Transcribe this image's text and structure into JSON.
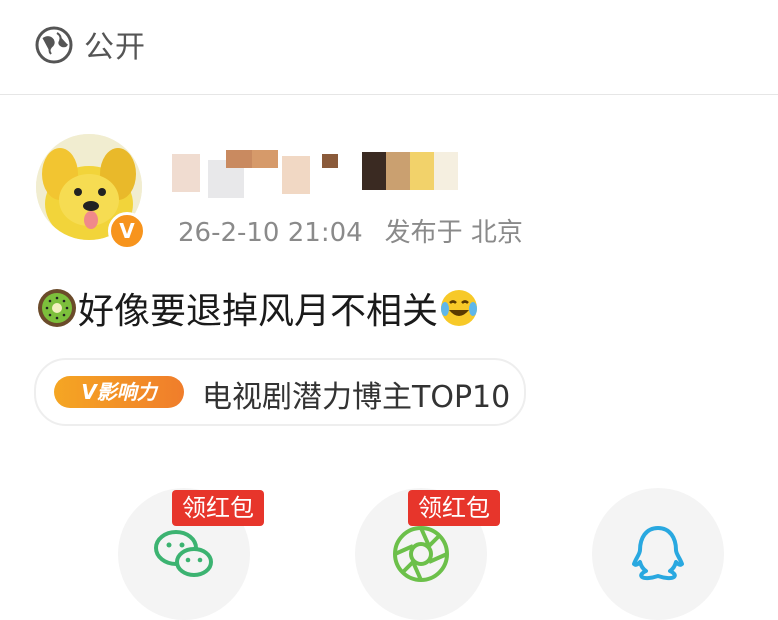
{
  "header": {
    "visibility": "公开",
    "icon": "globe-icon"
  },
  "post": {
    "author_avatar": "avatar-dog",
    "verified_badge": "V",
    "timestamp": "26-2-10 21:04",
    "location": "发布于 北京",
    "text": "好像要退掉风月不相关",
    "leading_emoji": "kiwi-emoji",
    "trailing_emoji": "laugh-cry-emoji"
  },
  "influence": {
    "badge": "V影响力",
    "text": "电视剧潜力博主TOP10"
  },
  "share": {
    "buttons": [
      {
        "name": "wechat",
        "icon": "wechat-icon",
        "tag": "领红包"
      },
      {
        "name": "moments",
        "icon": "moments-icon",
        "tag": "领红包"
      },
      {
        "name": "qq",
        "icon": "qq-icon"
      }
    ]
  },
  "colors": {
    "accent": "#f7941d",
    "red_tag": "#e7352b",
    "wechat": "#3cb371",
    "moments": "#6cc04a",
    "qq": "#29a8e0"
  }
}
